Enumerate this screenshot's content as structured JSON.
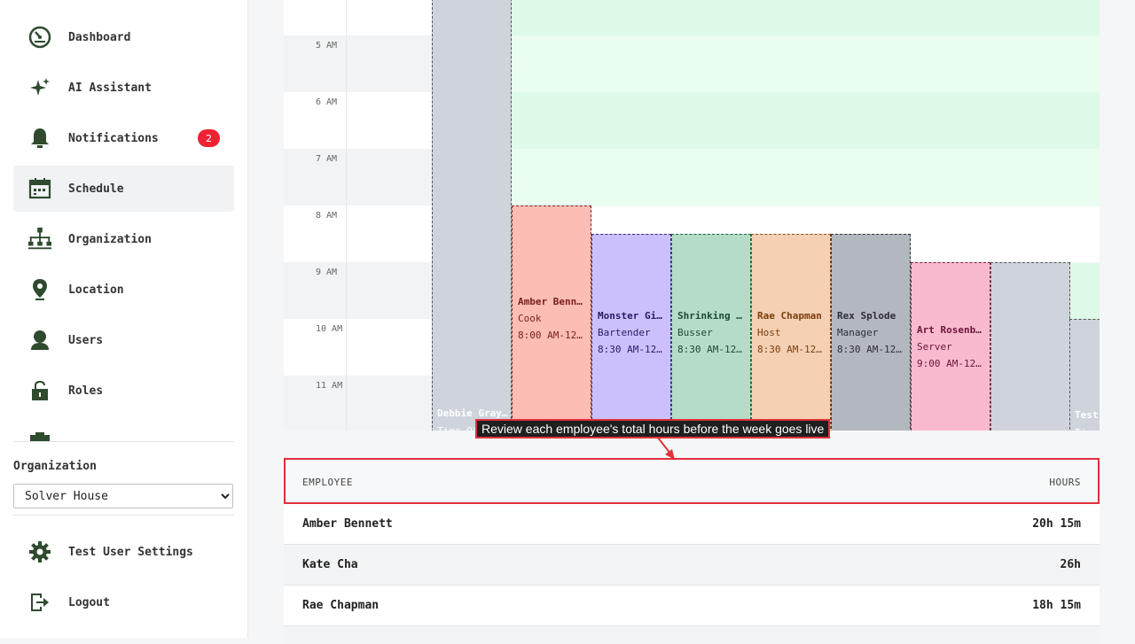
{
  "sidebar": {
    "items": [
      {
        "label": "Dashboard",
        "icon": "dashboard-icon"
      },
      {
        "label": "AI Assistant",
        "icon": "sparkle-icon"
      },
      {
        "label": "Notifications",
        "icon": "bell-icon",
        "badge": "2"
      },
      {
        "label": "Schedule",
        "icon": "calendar-icon",
        "active": true
      },
      {
        "label": "Organization",
        "icon": "org-chart-icon"
      },
      {
        "label": "Location",
        "icon": "location-pin-icon"
      },
      {
        "label": "Users",
        "icon": "user-icon"
      },
      {
        "label": "Roles",
        "icon": "lock-icon"
      }
    ],
    "org_label": "Organization",
    "org_selected": "Solver House",
    "settings_label": "Test User Settings",
    "logout_label": "Logout"
  },
  "calendar": {
    "time_labels": [
      "5 AM",
      "6 AM",
      "7 AM",
      "8 AM",
      "9 AM",
      "10 AM",
      "11 AM"
    ],
    "shifts": [
      {
        "name": "Debbie Gray…",
        "role": "Time Off"
      },
      {
        "name": "Amber Benne…",
        "role": "Cook",
        "time": "8:00 AM-12:…"
      },
      {
        "name": "Monster Girl",
        "role": "Bartender",
        "time": "8:30 AM-12:…"
      },
      {
        "name": "Shrinking R…",
        "role": "Busser",
        "time": "8:30 AM-12:…"
      },
      {
        "name": "Rae Chapman",
        "role": "Host",
        "time": "8:30 AM-12:…"
      },
      {
        "name": "Rex Splode",
        "role": "Manager",
        "time": "8:30 AM-12:…"
      },
      {
        "name": "Art Rosenba…",
        "role": "Server",
        "time": "9:00 AM-12:…"
      },
      {
        "name": "Test",
        "role": "Time Off"
      }
    ]
  },
  "colors": {
    "accent_red": "#e0303a",
    "available_green": "#ddfbe8",
    "badge_red": "#ee2233",
    "icon_green": "#2f4a2f"
  },
  "tooltip": "Review each employee's total hours before the week goes live",
  "table": {
    "headers": {
      "employee": "EMPLOYEE",
      "hours": "HOURS"
    },
    "rows": [
      {
        "employee": "Amber Bennett",
        "hours": "20h 15m"
      },
      {
        "employee": "Kate Cha",
        "hours": "26h"
      },
      {
        "employee": "Rae Chapman",
        "hours": "18h 15m"
      }
    ]
  }
}
